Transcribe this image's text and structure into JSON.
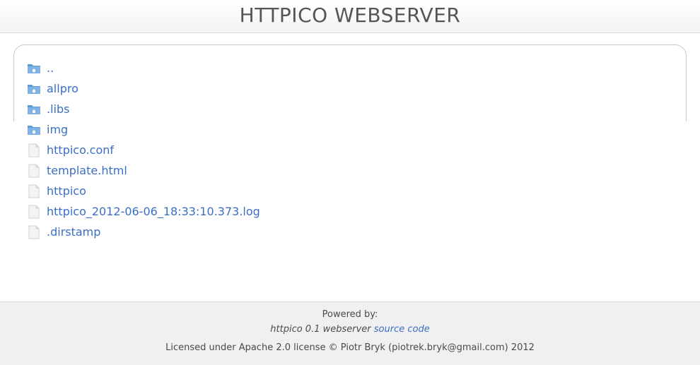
{
  "header": {
    "title": "HTTPICO WEBSERVER"
  },
  "entries": [
    {
      "name": "..",
      "type": "folder"
    },
    {
      "name": "allpro",
      "type": "folder"
    },
    {
      "name": ".libs",
      "type": "folder"
    },
    {
      "name": "img",
      "type": "folder"
    },
    {
      "name": "httpico.conf",
      "type": "file"
    },
    {
      "name": "template.html",
      "type": "file"
    },
    {
      "name": "httpico",
      "type": "file"
    },
    {
      "name": "httpico_2012-06-06_18:33:10.373.log",
      "type": "file"
    },
    {
      "name": ".dirstamp",
      "type": "file"
    }
  ],
  "footer": {
    "powered_by": "Powered by:",
    "software": "httpico 0.1 webserver",
    "source_link": "source code",
    "license": "Licensed under Apache 2.0 license © Piotr Bryk (piotrek.bryk@gmail.com) 2012"
  },
  "colors": {
    "link": "#3a6fc4",
    "folder_icon": "#5b9bd8",
    "file_icon": "#e6e6e6"
  },
  "icons": {
    "folder": "folder-icon",
    "file": "file-icon"
  }
}
